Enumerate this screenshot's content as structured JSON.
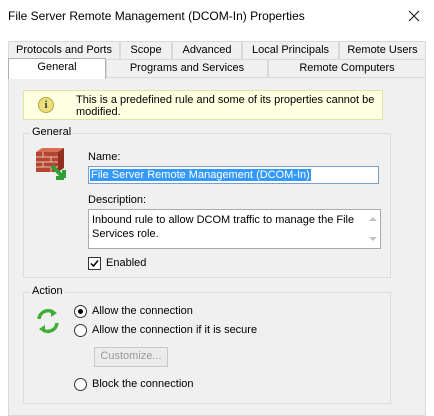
{
  "window": {
    "title": "File Server Remote Management (DCOM-In) Properties"
  },
  "tabs": {
    "row1": [
      "Protocols and Ports",
      "Scope",
      "Advanced",
      "Local Principals",
      "Remote Users"
    ],
    "row2": [
      "General",
      "Programs and Services",
      "Remote Computers"
    ],
    "active": "General"
  },
  "info": {
    "icon": "info-icon",
    "message": "This is a predefined rule and some of its properties cannot be modified."
  },
  "general_group": {
    "legend": "General",
    "icon": "firewall-rule-icon",
    "name_label": "Name:",
    "name_value": "File Server Remote Management (DCOM-In)",
    "description_label": "Description:",
    "description_value": "Inbound rule to allow DCOM traffic to manage the File Services role.",
    "enabled_label": "Enabled",
    "enabled_checked": true
  },
  "action_group": {
    "legend": "Action",
    "icon": "action-arrows-icon",
    "options": [
      {
        "label": "Allow the connection",
        "selected": true
      },
      {
        "label": "Allow the connection if it is secure",
        "selected": false
      },
      {
        "label": "Block the connection",
        "selected": false
      }
    ],
    "customize_label": "Customize..."
  }
}
